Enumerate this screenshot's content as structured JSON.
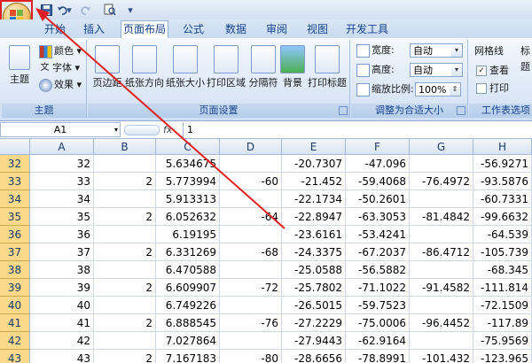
{
  "tabs": [
    "开始",
    "插入",
    "页面布局",
    "公式",
    "数据",
    "审阅",
    "视图",
    "开发工具"
  ],
  "active_tab": "页面布局",
  "ribbon": {
    "theme_group": {
      "label": "主题",
      "theme_button": "主题",
      "colors": "颜色",
      "fonts": "字体",
      "effects": "效果"
    },
    "page_setup_group": {
      "label": "页面设置",
      "buttons": [
        "页边距",
        "纸张方向",
        "纸张大小",
        "打印区域",
        "分隔符",
        "背景",
        "打印标题"
      ]
    },
    "scale_group": {
      "label": "调整为合适大小",
      "width_label": "宽度:",
      "width_value": "自动",
      "height_label": "高度:",
      "height_value": "自动",
      "scale_label": "缩放比例:",
      "scale_value": "100%"
    },
    "sheet_options_group": {
      "label": "工作表选项",
      "gridlines": "网格线",
      "headings": "标题",
      "view": "查看",
      "print": "打印",
      "view_checked": true,
      "print_checked": false
    }
  },
  "formula_bar": {
    "name_box": "A1",
    "fx": "fx",
    "formula": "1"
  },
  "columns": [
    "A",
    "B",
    "C",
    "D",
    "E",
    "F",
    "G",
    "H"
  ],
  "rows": [
    {
      "num": "32",
      "cells": [
        "32",
        "",
        "5.634675",
        "",
        "-20.7307",
        "-47.096",
        "",
        "-56.9271"
      ]
    },
    {
      "num": "33",
      "cells": [
        "33",
        "2",
        "5.773994",
        "-60",
        "-21.452",
        "-59.4068",
        "-76.4972",
        "-93.5876"
      ]
    },
    {
      "num": "34",
      "cells": [
        "34",
        "",
        "5.913313",
        "",
        "-22.1734",
        "-50.2601",
        "",
        "-60.7331"
      ]
    },
    {
      "num": "35",
      "cells": [
        "35",
        "2",
        "6.052632",
        "-64",
        "-22.8947",
        "-63.3053",
        "-81.4842",
        "-99.6632"
      ]
    },
    {
      "num": "36",
      "cells": [
        "36",
        "",
        "6.19195",
        "",
        "-23.6161",
        "-53.4241",
        "",
        "-64.539"
      ]
    },
    {
      "num": "37",
      "cells": [
        "37",
        "2",
        "6.331269",
        "-68",
        "-24.3375",
        "-67.2037",
        "-86.4712",
        "-105.739"
      ]
    },
    {
      "num": "38",
      "cells": [
        "38",
        "",
        "6.470588",
        "",
        "-25.0588",
        "-56.5882",
        "",
        "-68.345"
      ]
    },
    {
      "num": "39",
      "cells": [
        "39",
        "2",
        "6.609907",
        "-72",
        "-25.7802",
        "-71.1022",
        "-91.4582",
        "-111.814"
      ]
    },
    {
      "num": "40",
      "cells": [
        "40",
        "",
        "6.749226",
        "",
        "-26.5015",
        "-59.7523",
        "",
        "-72.1509"
      ]
    },
    {
      "num": "41",
      "cells": [
        "41",
        "2",
        "6.888545",
        "-76",
        "-27.2229",
        "-75.0006",
        "-96.4452",
        "-117.89"
      ]
    },
    {
      "num": "42",
      "cells": [
        "42",
        "",
        "7.027864",
        "",
        "-27.9443",
        "-62.9164",
        "",
        "-75.9569"
      ]
    },
    {
      "num": "43",
      "cells": [
        "43",
        "2",
        "7.167183",
        "-80",
        "-28.6656",
        "-78.8991",
        "-101.432",
        "-123.965"
      ]
    }
  ],
  "colors": {
    "highlight": "#e02020",
    "row_header": "#fbd98a",
    "ribbon_text": "#15428b"
  },
  "icons": {
    "office_button": "office-logo-icon",
    "save": "save-icon",
    "undo": "undo-icon",
    "redo": "redo-icon"
  }
}
